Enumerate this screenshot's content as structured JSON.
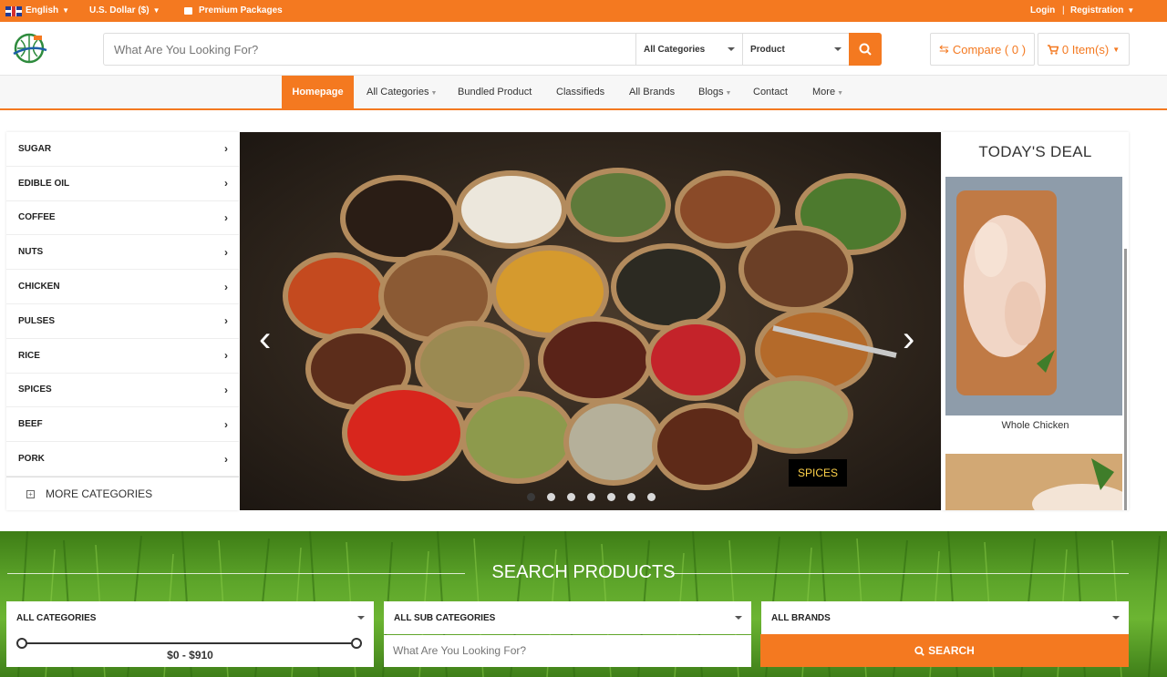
{
  "topbar": {
    "language": "English",
    "currency": "U.S. Dollar ($)",
    "premium": "Premium Packages",
    "login": "Login",
    "separator": "|",
    "registration": "Registration"
  },
  "header": {
    "search_placeholder": "What Are You Looking For?",
    "category_select": "All Categories",
    "type_select": "Product",
    "compare": "Compare ( 0 )",
    "cart": "0 Item(s)"
  },
  "nav": {
    "items": [
      "Homepage",
      "All Categories",
      "Bundled Product",
      "Classifieds",
      "All Brands",
      "Blogs",
      "Contact",
      "More"
    ]
  },
  "sidebar": {
    "categories": [
      "SUGAR",
      "EDIBLE OIL",
      "COFFEE",
      "NUTS",
      "CHICKEN",
      "PULSES",
      "RICE",
      "SPICES",
      "BEEF",
      "PORK"
    ],
    "more": "MORE CATEGORIES"
  },
  "slider": {
    "label": "SPICES",
    "prev": "‹",
    "next": "›"
  },
  "deal": {
    "title": "TODAY'S DEAL",
    "product": "Whole Chicken"
  },
  "search_products": {
    "title": "SEARCH PRODUCTS",
    "categories": "ALL CATEGORIES",
    "sub_categories": "ALL SUB CATEGORIES",
    "brands": "ALL BRANDS",
    "price_range": "$0 - $910",
    "input_placeholder": "What Are You Looking For?",
    "search_button": "SEARCH"
  },
  "colors": {
    "accent": "#f47920",
    "label_text": "#ffd24a"
  }
}
